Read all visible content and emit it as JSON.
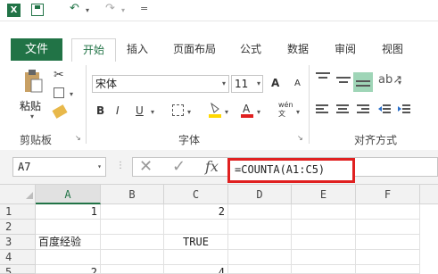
{
  "titlebar": {
    "app_icon": "X",
    "undo": "↶",
    "redo": "↷",
    "customize": "="
  },
  "tabs": [
    {
      "label": "文件"
    },
    {
      "label": "开始"
    },
    {
      "label": "插入"
    },
    {
      "label": "页面布局"
    },
    {
      "label": "公式"
    },
    {
      "label": "数据"
    },
    {
      "label": "审阅"
    },
    {
      "label": "视图"
    }
  ],
  "ribbon": {
    "clipboard": {
      "paste_label": "粘贴",
      "group_label": "剪贴板"
    },
    "font": {
      "font_name": "宋体",
      "font_size": "11",
      "bold": "B",
      "italic": "I",
      "underline": "U",
      "grow": "A",
      "shrink": "A",
      "font_color_letter": "A",
      "wen": "wén 文",
      "group_label": "字体"
    },
    "alignment": {
      "group_label": "对齐方式"
    }
  },
  "formula_bar": {
    "name_box": "A7",
    "cancel": "✕",
    "enter": "✓",
    "fx": "fx",
    "formula": "=COUNTA(A1:C5)"
  },
  "grid": {
    "columns": [
      "A",
      "B",
      "C",
      "D",
      "E",
      "F"
    ],
    "rows": [
      {
        "n": "1",
        "a": "1",
        "b": "",
        "c": "2"
      },
      {
        "n": "2",
        "a": "",
        "b": "",
        "c": ""
      },
      {
        "n": "3",
        "a": "百度经验",
        "b": "",
        "c": "TRUE"
      },
      {
        "n": "4",
        "a": "",
        "b": "",
        "c": ""
      },
      {
        "n": "5",
        "a": "2",
        "b": "",
        "c": "4"
      }
    ]
  }
}
